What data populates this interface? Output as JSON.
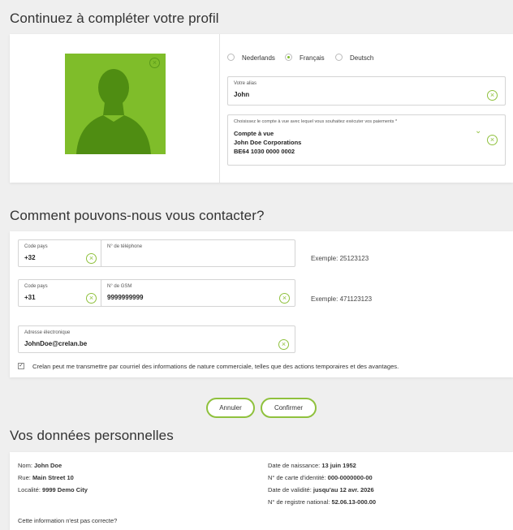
{
  "profile": {
    "section_title": "Continuez à compléter votre profil",
    "languages": [
      {
        "label": "Nederlands",
        "selected": false
      },
      {
        "label": "Français",
        "selected": true
      },
      {
        "label": "Deutsch",
        "selected": false
      }
    ],
    "alias": {
      "label": "Votre alias",
      "value": "John"
    },
    "account": {
      "label": "Choisissez le compte à vue avec lequel vous souhaitez exécuter vos paiements *",
      "line1": "Compte à vue",
      "line2": "John Doe Corporations",
      "line3": "BE64 1030 0000 0002"
    }
  },
  "contact": {
    "section_title": "Comment pouvons-nous vous contacter?",
    "phone": {
      "country_label": "Code pays",
      "country_value": "+32",
      "number_label": "N° de téléphone",
      "number_value": "",
      "example": "Exemple: 25123123"
    },
    "mobile": {
      "country_label": "Code pays",
      "country_value": "+31",
      "number_label": "N° de GSM",
      "number_value": "9999999999",
      "example": "Exemple: 471123123"
    },
    "email": {
      "label": "Adresse électronique",
      "value": "JohnDoe@crelan.be"
    },
    "consent": "Crelan peut me transmettre par courriel des informations de nature commerciale, telles que des actions temporaires et des avantages."
  },
  "actions": {
    "cancel": "Annuler",
    "confirm": "Confirmer"
  },
  "personal": {
    "section_title": "Vos données personnelles",
    "name_label": "Nom:",
    "name_value": "John Doe",
    "street_label": "Rue:",
    "street_value": "Main Street 10",
    "city_label": "Localité:",
    "city_value": "9999 Demo City",
    "birth_label": "Date de naissance:",
    "birth_value": "13 juin 1952",
    "id_label": "N° de carte d'identité:",
    "id_value": "000-0000000-00",
    "validity_label": "Date de validité:",
    "validity_value": "jusqu'au 12 avr. 2026",
    "national_label": "N° de registre national:",
    "national_value": "52.06.13-000.00",
    "incorrect_question": "Cette information n'est pas correcte?"
  },
  "colors": {
    "accent": "#8fc13d",
    "avatar_bg": "#7fbd2a"
  }
}
